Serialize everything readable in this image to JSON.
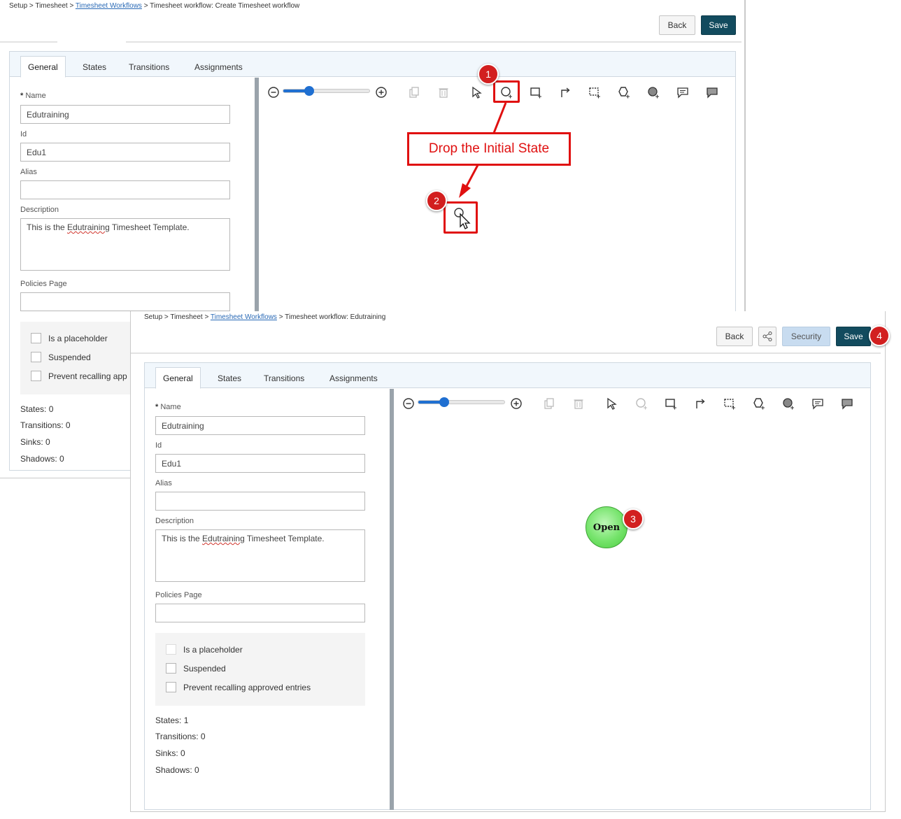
{
  "screen1": {
    "breadcrumb": {
      "part1": "Setup > Timesheet > ",
      "link": "Timesheet Workflows",
      "part2": " > Timesheet workflow: Create Timesheet workflow"
    },
    "back_label": "Back",
    "save_label": "Save",
    "tabs": [
      "General",
      "States",
      "Transitions",
      "Assignments"
    ],
    "form": {
      "name_label": "Name",
      "name_value": "Edutraining",
      "id_label": "Id",
      "id_value": "Edu1",
      "alias_label": "Alias",
      "alias_value": "",
      "description_label": "Description",
      "description_pre": "This is the ",
      "description_mark": "Edutraining",
      "description_post": " Timesheet Template.",
      "policies_label": "Policies Page",
      "policies_value": ""
    },
    "checkboxes": [
      "Is a placeholder",
      "Suspended",
      "Prevent recalling app"
    ],
    "stats": [
      "States: 0",
      "Transitions: 0",
      "Sinks: 0",
      "Shadows: 0"
    ]
  },
  "screen2": {
    "breadcrumb": {
      "part1": "Setup > Timesheet > ",
      "link": "Timesheet Workflows",
      "part2": " > Timesheet workflow: Edutraining"
    },
    "back_label": "Back",
    "security_label": "Security",
    "save_label": "Save",
    "tabs": [
      "General",
      "States",
      "Transitions",
      "Assignments"
    ],
    "form": {
      "name_label": "Name",
      "name_value": "Edutraining",
      "id_label": "Id",
      "id_value": "Edu1",
      "alias_label": "Alias",
      "alias_value": "",
      "description_label": "Description",
      "description_pre": "This is the ",
      "description_mark": "Edutraining",
      "description_post": " Timesheet Template.",
      "policies_label": "Policies Page",
      "policies_value": ""
    },
    "checkboxes": [
      "Is a placeholder",
      "Suspended",
      "Prevent recalling approved entries"
    ],
    "stats": [
      "States: 1",
      "Transitions: 0",
      "Sinks: 0",
      "Shadows: 0"
    ],
    "state_node_label": "Open"
  },
  "annotations": {
    "callout": "Drop the Initial State",
    "markers": [
      "1",
      "2",
      "3",
      "4"
    ]
  },
  "zoom_level": 0.3,
  "colors": {
    "save": "#124b5e",
    "link": "#2a6ab6",
    "annotation": "#e01010",
    "security": "#c8dcf0",
    "node": "#74e36a"
  }
}
